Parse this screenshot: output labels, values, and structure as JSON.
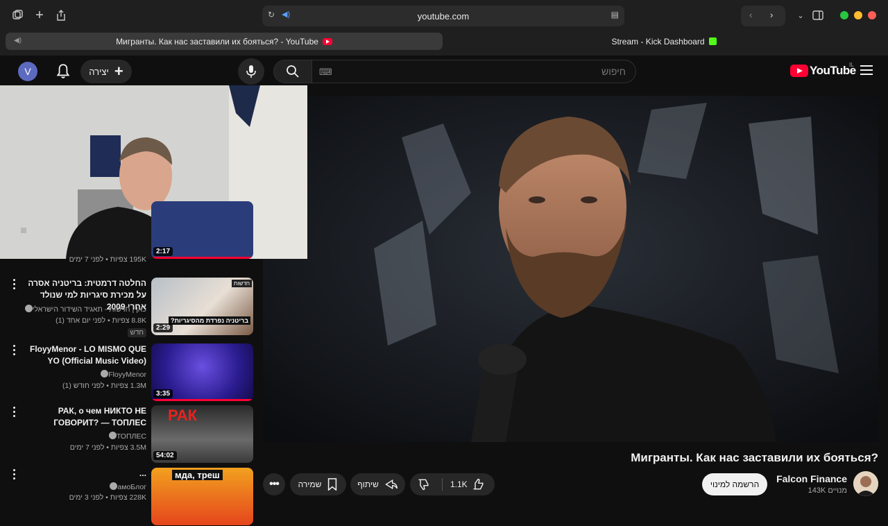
{
  "browser": {
    "address": "youtube.com",
    "tabs": [
      {
        "title": "Мигранты. Как нас заставили их бояться? - YouTube"
      },
      {
        "title": "Stream - Kick Dashboard"
      }
    ]
  },
  "yt_header": {
    "avatar_letter": "V",
    "create_label": "יצירה",
    "search_placeholder": "חיפוש",
    "logo_text": "YouTube",
    "region": "IL"
  },
  "video": {
    "title": "Мигранты. Как нас заставили их бояться?",
    "channel": "Falcon Finance",
    "subscribers": "143K מנויים",
    "subscribe_label": "הרשמה למינוי",
    "likes": "1.1K",
    "share_label": "שיתוף",
    "save_label": "שמירה"
  },
  "recommendations": [
    {
      "title": "",
      "channel": "",
      "meta": "195K צפיות • לפני 7 ימים",
      "duration": "2:17",
      "progress": 1.0
    },
    {
      "title": "החלטה דרמטית: בריטניה אסרה על מכירת סיגריות למי שנולד אחרי 2009",
      "channel": "כאן | חדשות - תאגיד השידור הישראלי",
      "meta": "8.8K צפיות • לפני יום אחד (1)",
      "badge": "חדש",
      "duration": "2:29",
      "thumb_caption": "בריטניה נפרדת מהסיגריות?",
      "thumb_tag": "חדשות",
      "progress": 0
    },
    {
      "title": "FloyyMenor - LO MISMO QUE YO (Official Music Video)",
      "channel": "FloyyMenor",
      "meta": "1.3M צפיות • לפני חודש (1)",
      "duration": "3:35",
      "progress": 1.0
    },
    {
      "title": "РАК, о чем НИКТО НЕ ГОВОРИТ? — ТОПЛЕС",
      "channel": "ТОПЛЕС",
      "meta": "3.5M צפיות • לפני 7 ימים",
      "duration": "54:02",
      "thumb_caption": "РАК",
      "progress": 0
    },
    {
      "title": "...",
      "channel": "амоБлог",
      "meta": "228K צפיות • לפני 3 ימים",
      "duration": "",
      "thumb_caption": "мда, треш",
      "progress": 0
    }
  ],
  "colors": {
    "background": "#0f0f0f",
    "accent": "#ff0033",
    "kick": "#53fc18"
  }
}
